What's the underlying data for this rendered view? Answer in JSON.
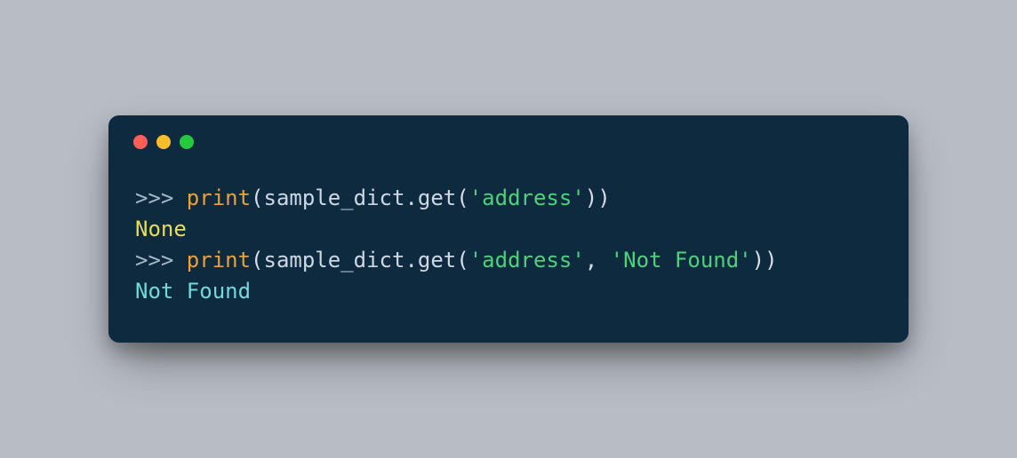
{
  "window": {
    "dot_red": "#ff5f56",
    "dot_yellow": "#ffbd2e",
    "dot_green": "#27c93f",
    "bg": "#0d2a3f"
  },
  "code": {
    "lines": [
      {
        "tokens": [
          {
            "cls": "tok-prompt",
            "text": ">>> "
          },
          {
            "cls": "tok-func",
            "text": "print"
          },
          {
            "cls": "tok-punct",
            "text": "("
          },
          {
            "cls": "tok-ident",
            "text": "sample_dict"
          },
          {
            "cls": "tok-dot",
            "text": "."
          },
          {
            "cls": "tok-ident",
            "text": "get"
          },
          {
            "cls": "tok-punct",
            "text": "("
          },
          {
            "cls": "tok-string",
            "text": "'address'"
          },
          {
            "cls": "tok-punct",
            "text": ")"
          },
          {
            "cls": "tok-punct",
            "text": ")"
          }
        ]
      },
      {
        "tokens": [
          {
            "cls": "tok-output-y",
            "text": "None"
          }
        ]
      },
      {
        "tokens": [
          {
            "cls": "tok-prompt",
            "text": ">>> "
          },
          {
            "cls": "tok-func",
            "text": "print"
          },
          {
            "cls": "tok-punct",
            "text": "("
          },
          {
            "cls": "tok-ident",
            "text": "sample_dict"
          },
          {
            "cls": "tok-dot",
            "text": "."
          },
          {
            "cls": "tok-ident",
            "text": "get"
          },
          {
            "cls": "tok-punct",
            "text": "("
          },
          {
            "cls": "tok-string",
            "text": "'address'"
          },
          {
            "cls": "tok-punct",
            "text": ", "
          },
          {
            "cls": "tok-string",
            "text": "'Not Found'"
          },
          {
            "cls": "tok-punct",
            "text": ")"
          },
          {
            "cls": "tok-punct",
            "text": ")"
          }
        ]
      },
      {
        "tokens": [
          {
            "cls": "tok-output-c",
            "text": "Not Found"
          }
        ]
      }
    ]
  }
}
